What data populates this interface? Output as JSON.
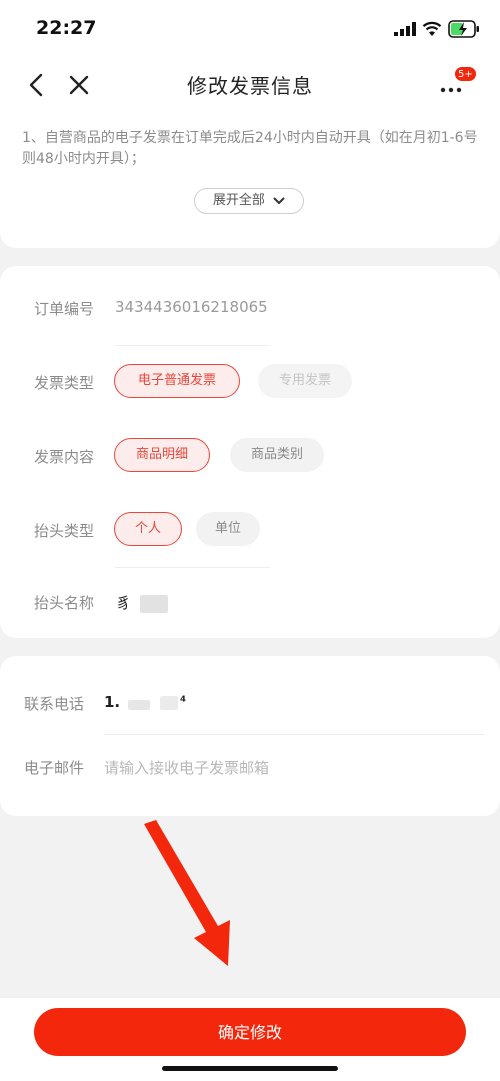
{
  "status_bar": {
    "time": "22:27"
  },
  "nav": {
    "title": "修改发票信息",
    "more_badge": "5+"
  },
  "notice": {
    "text": "1、自营商品的电子发票在订单完成后24小时内自动开具（如在月初1-6号则48小时内开具）；",
    "expand_label": "展开全部"
  },
  "invoice": {
    "order_no": {
      "label": "订单编号",
      "value": "3434436016218065"
    },
    "type": {
      "label": "发票类型",
      "options": [
        "电子普通发票",
        "专用发票"
      ],
      "selected": "电子普通发票"
    },
    "content": {
      "label": "发票内容",
      "options": [
        "商品明细",
        "商品类别"
      ],
      "selected": "商品明细"
    },
    "title_type": {
      "label": "抬头类型",
      "options": [
        "个人",
        "单位"
      ],
      "selected": "个人"
    },
    "title_name": {
      "label": "抬头名称",
      "value": "豸"
    }
  },
  "contact": {
    "phone": {
      "label": "联系电话",
      "value_start": "1.",
      "value_end": "⁴"
    },
    "email": {
      "label": "电子邮件",
      "placeholder": "请输入接收电子发票邮箱"
    }
  },
  "footer": {
    "confirm_label": "确定修改"
  },
  "colors": {
    "accent": "#f2270c",
    "chip_selected": "#e8473a",
    "background": "#f2f2f2"
  }
}
